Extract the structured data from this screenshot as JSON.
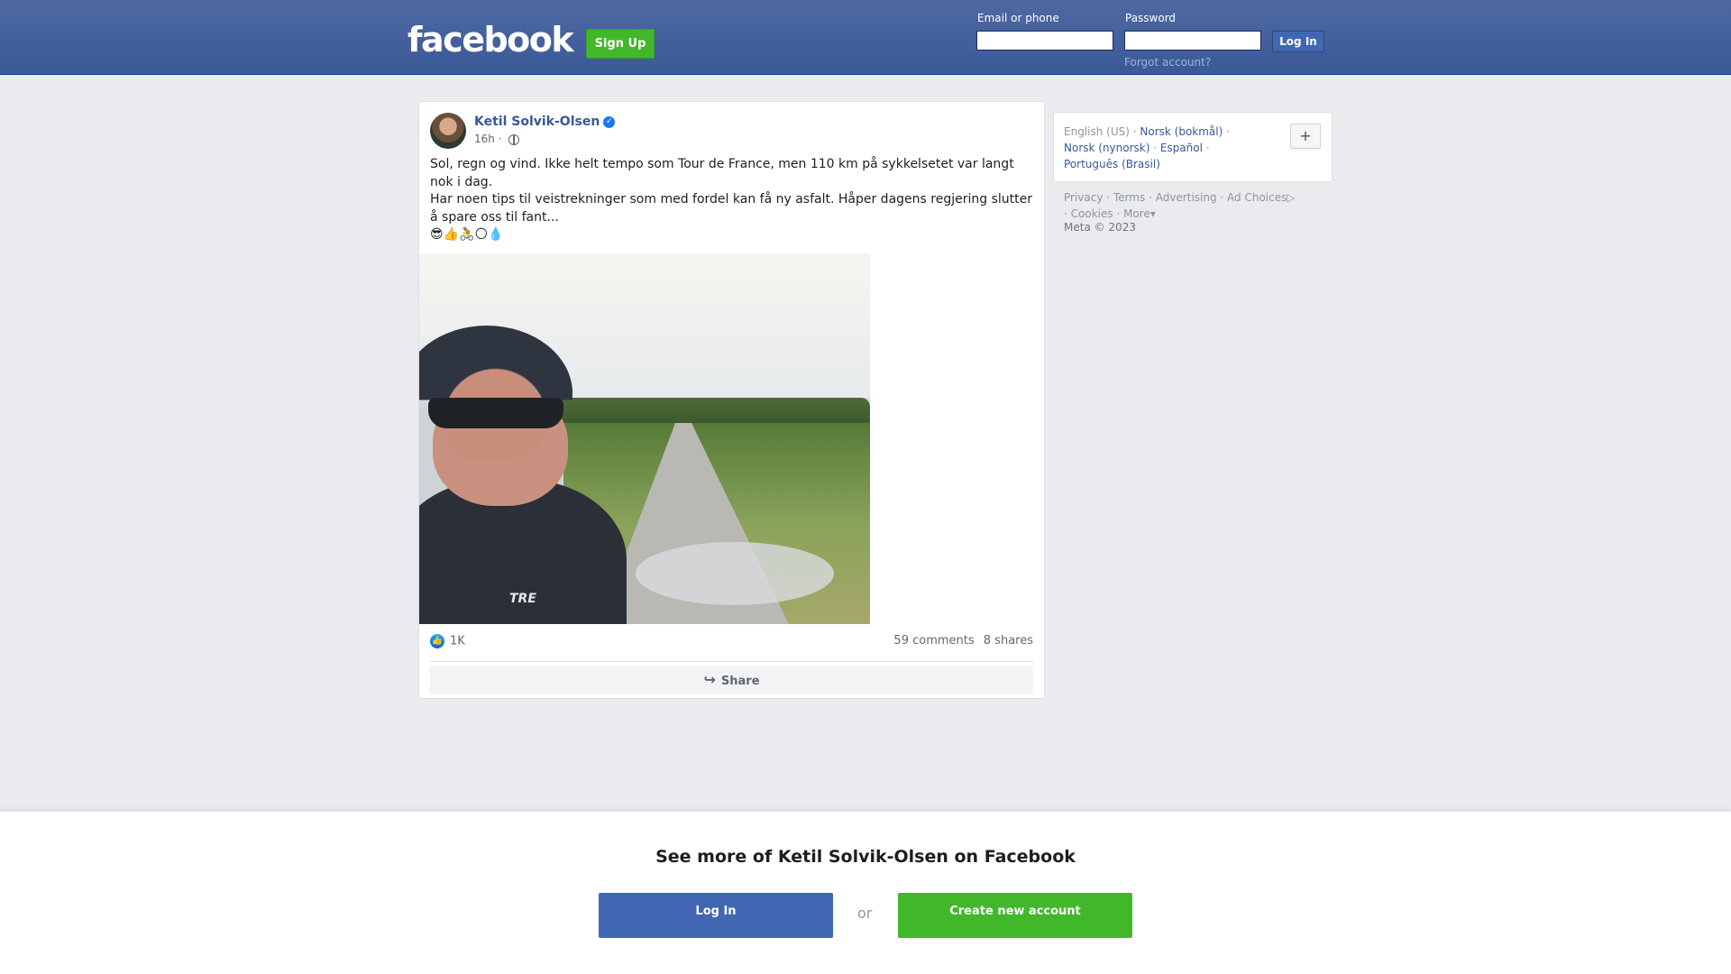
{
  "header": {
    "logo": "facebook",
    "signup_label": "Sign Up",
    "email_label": "Email or phone",
    "password_label": "Password",
    "login_label": "Log In",
    "forgot_label": "Forgot account?"
  },
  "post": {
    "author": "Ketil Solvik-Olsen",
    "verified": true,
    "time": "16h",
    "audience_icon": "globe-icon",
    "text_line1": "Sol, regn og vind. Ikke helt tempo som Tour de France, men 110 km på sykkelsetet var langt nok i dag.",
    "text_line2": "Har noen tips til veistrekninger som med fordel kan få ny asfalt. Håper dagens regjering slutter å spare oss til fant...",
    "emojis": "😎👍🚴🌕💧",
    "photo_brand_text": "TRE",
    "likes": "1K",
    "comments": "59 comments",
    "shares": "8 shares",
    "share_label": "Share"
  },
  "sidebar": {
    "languages": {
      "current": "English (US)",
      "items": [
        "Norsk (bokmål)",
        "Norsk (nynorsk)",
        "Español",
        "Português (Brasil)"
      ]
    },
    "add_language": "+",
    "footer": {
      "links": [
        "Privacy",
        "Terms",
        "Advertising",
        "Ad Choices",
        "Cookies",
        "More"
      ],
      "copyright": "Meta © 2023"
    }
  },
  "banner": {
    "title": "See more of Ketil Solvik-Olsen on Facebook",
    "login_label": "Log In",
    "or_label": "or",
    "create_label": "Create new account"
  },
  "colors": {
    "brand_blue": "#3b5998",
    "green": "#42b72a",
    "link_blue": "#385898"
  }
}
